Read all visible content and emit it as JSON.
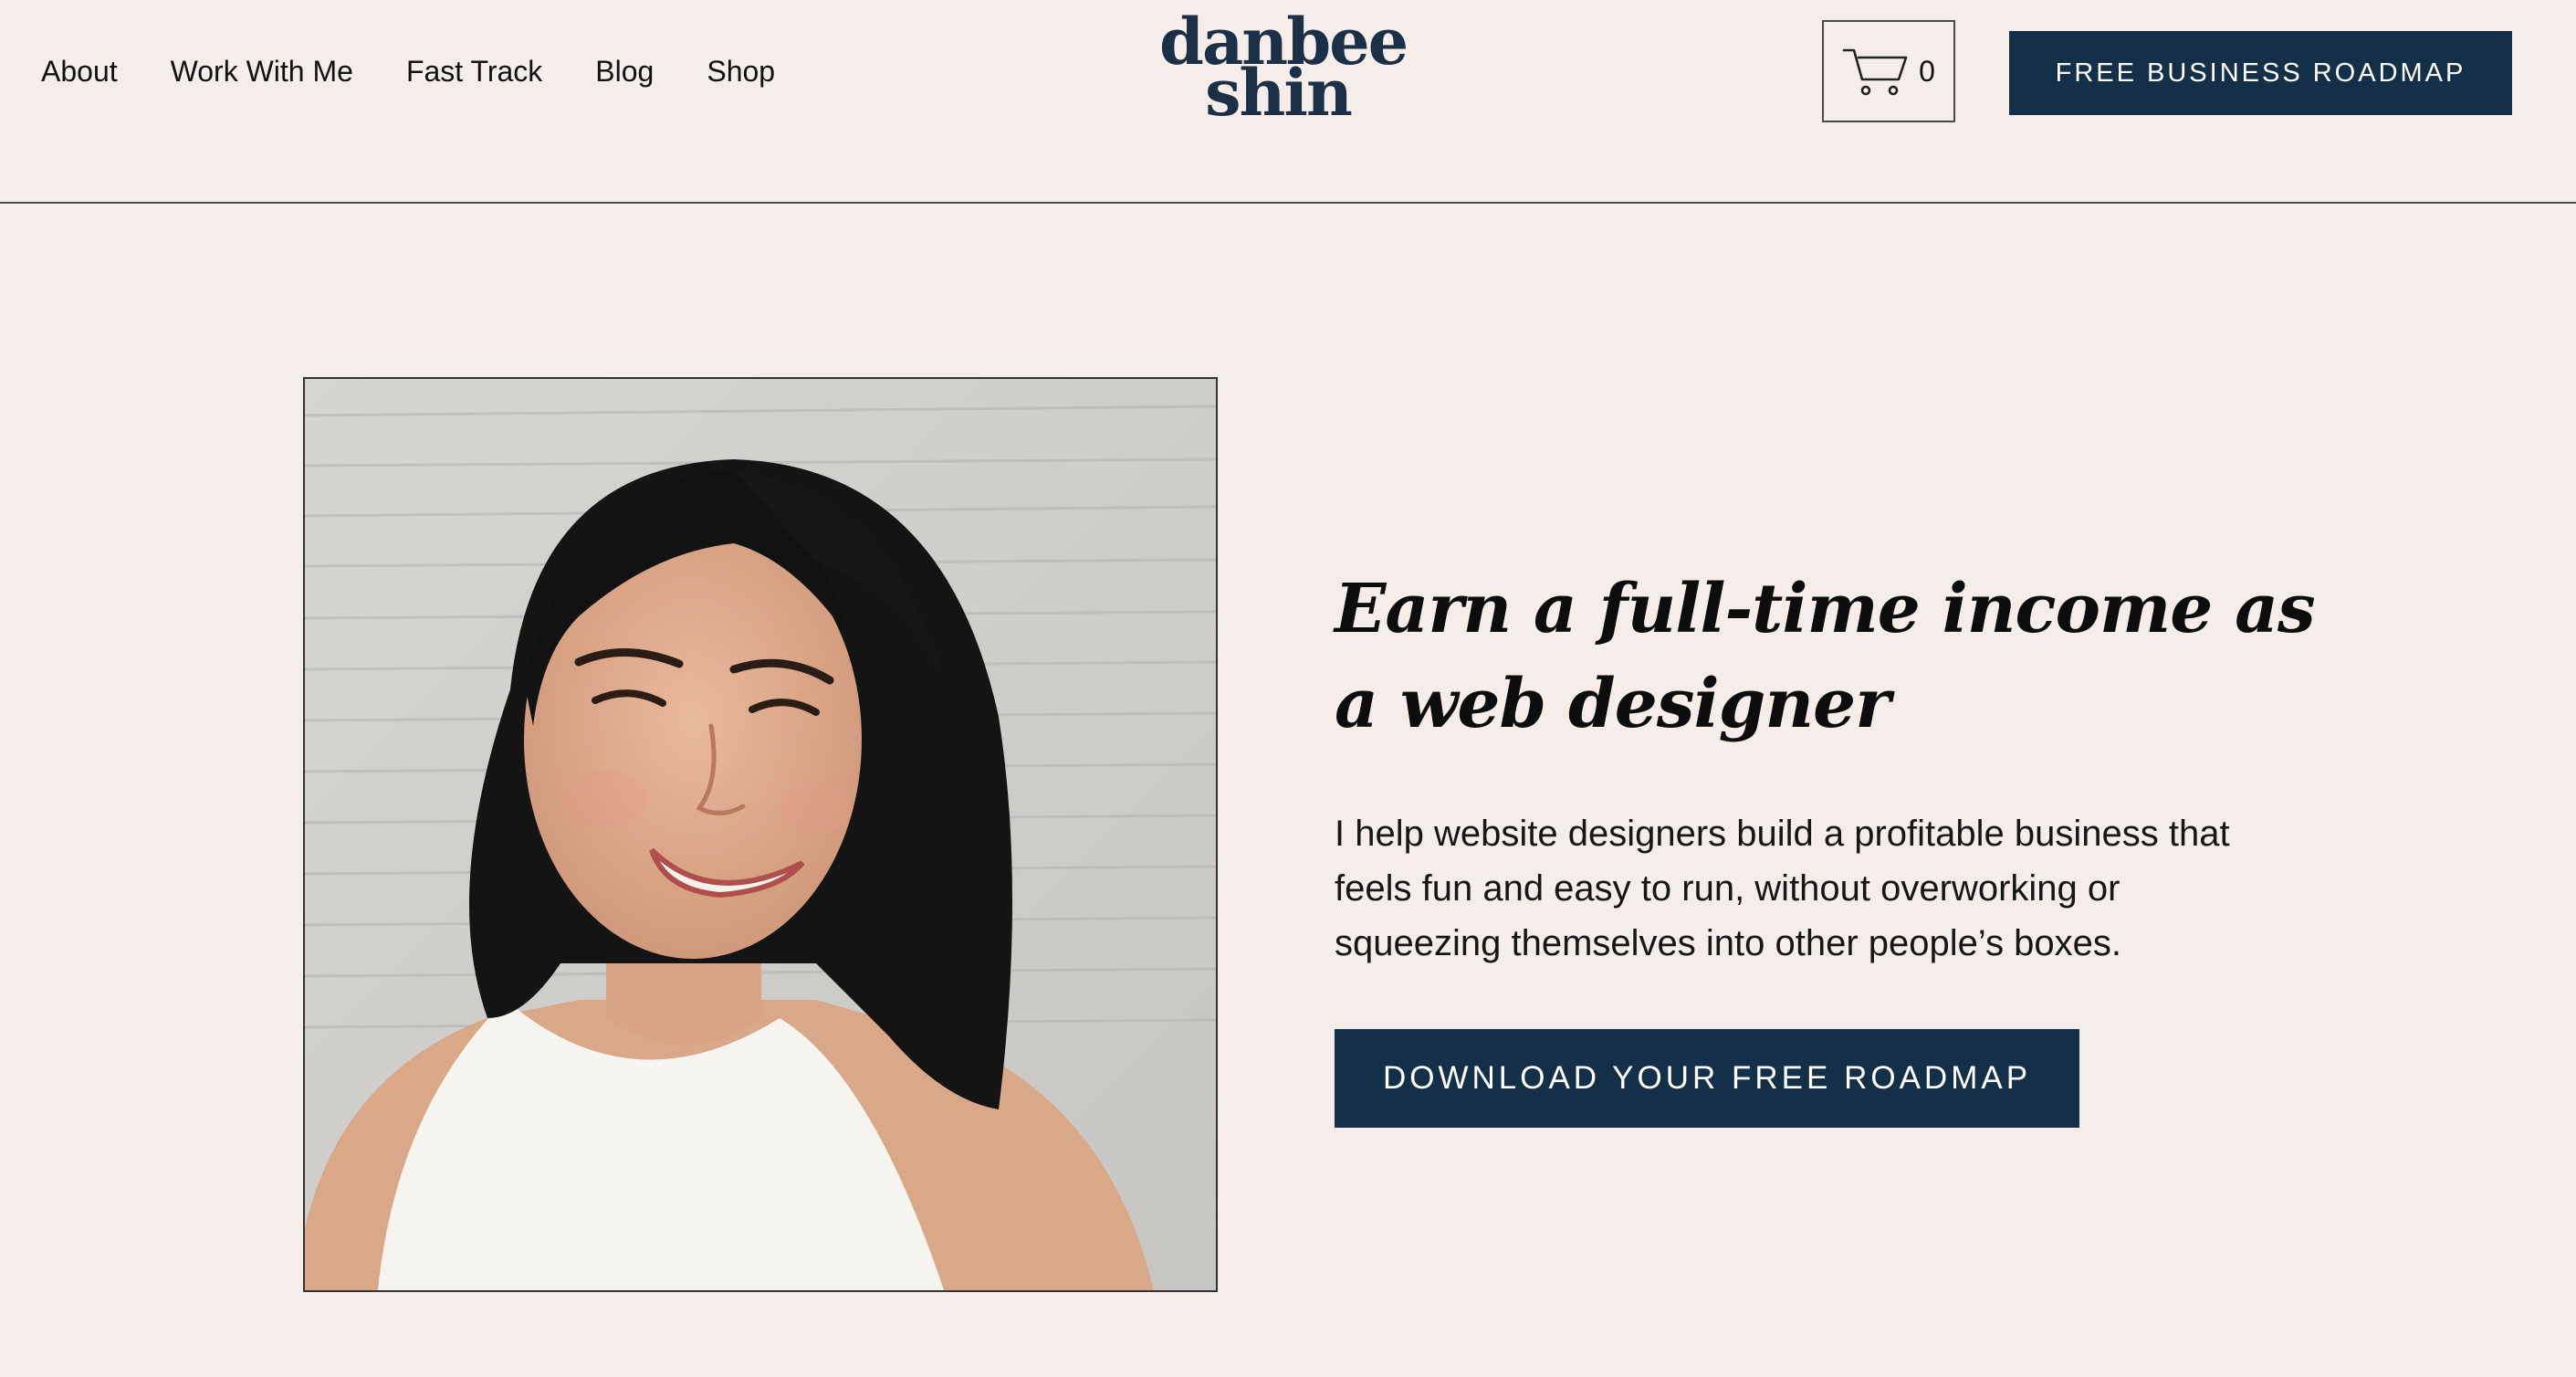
{
  "nav": {
    "items": [
      {
        "label": "About"
      },
      {
        "label": "Work With Me"
      },
      {
        "label": "Fast Track"
      },
      {
        "label": "Blog"
      },
      {
        "label": "Shop"
      }
    ]
  },
  "logo": {
    "line1": "danbee",
    "line2": "shin"
  },
  "cart": {
    "icon": "cart-icon",
    "count": "0"
  },
  "header": {
    "cta_label": "FREE BUSINESS ROADMAP"
  },
  "hero": {
    "title": "Earn a full-time income as a web designer",
    "subtitle": "I help website designers build a profitable business that feels fun and easy to run, without overworking or squeezing themselves into other people’s boxes.",
    "cta_label": "DOWNLOAD YOUR FREE ROADMAP"
  },
  "colors": {
    "background": "#f4edea",
    "brand_navy": "#133048",
    "logo": "#1b2f47",
    "text": "#111111"
  }
}
